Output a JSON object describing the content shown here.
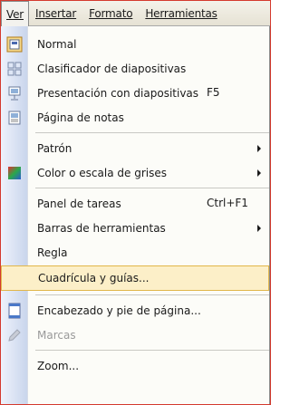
{
  "menubar": {
    "items": [
      "Ver",
      "Insertar",
      "Formato",
      "Herramientas"
    ]
  },
  "menu": {
    "items": [
      {
        "label": "Normal",
        "icon": "normal-view-icon"
      },
      {
        "label": "Clasificador de diapositivas",
        "icon": "slide-sorter-icon"
      },
      {
        "label": "Presentación con diapositivas",
        "shortcut": "F5",
        "icon": "slideshow-icon"
      },
      {
        "label": "Página de notas",
        "icon": "notes-page-icon"
      },
      {
        "label": "Patrón",
        "submenu": true
      },
      {
        "label": "Color o escala de grises",
        "submenu": true,
        "icon": "color-grayscale-icon"
      },
      {
        "label": "Panel de tareas",
        "shortcut": "Ctrl+F1"
      },
      {
        "label": "Barras de herramientas",
        "submenu": true
      },
      {
        "label": "Regla"
      },
      {
        "label": "Cuadrícula y guías...",
        "highlighted": true
      },
      {
        "label": "Encabezado y pie de página...",
        "icon": "header-footer-icon"
      },
      {
        "label": "Marcas",
        "disabled": true,
        "icon": "markup-icon"
      },
      {
        "label": "Zoom..."
      }
    ]
  },
  "colors": {
    "frame": "#d43a2e",
    "highlight_bg": "#fcefc8",
    "highlight_border": "#e1b64a",
    "gutter": "#c9d5ec"
  }
}
